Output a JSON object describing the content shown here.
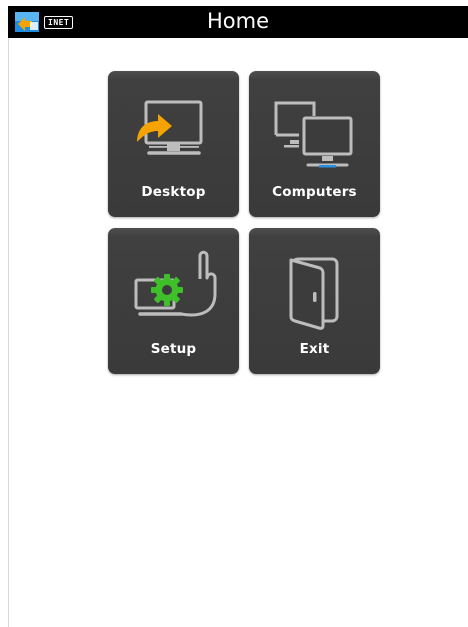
{
  "header": {
    "title": "Home",
    "status_badge": "INET",
    "app_icon": "network-app-icon"
  },
  "tiles": [
    {
      "label": "Desktop",
      "icon": "desktop-monitor-arrow-icon"
    },
    {
      "label": "Computers",
      "icon": "computers-monitors-icon"
    },
    {
      "label": "Setup",
      "icon": "setup-gear-laptop-icon"
    },
    {
      "label": "Exit",
      "icon": "door-exit-icon"
    }
  ],
  "colors": {
    "header_bg": "#000000",
    "tile_bg": "#3c3c3c",
    "icon_stroke": "#bdbdbd",
    "accent_orange": "#f5a300",
    "accent_green": "#3fbf2a",
    "accent_blue": "#2b8fe0"
  }
}
